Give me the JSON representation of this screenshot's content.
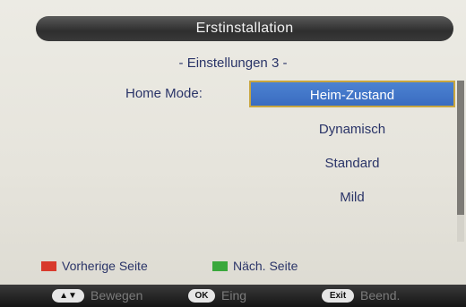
{
  "header": {
    "title": "Erstinstallation"
  },
  "page": {
    "subtitle": "- Einstellungen 3 -"
  },
  "home_mode": {
    "label": "Home Mode:",
    "options": [
      "Heim-Zustand",
      "Dynamisch",
      "Standard",
      "Mild"
    ],
    "selected": "Heim-Zustand"
  },
  "legend": {
    "prev": {
      "label": "Vorherige Seite",
      "color": "#d83a2c"
    },
    "next": {
      "label": "Näch. Seite",
      "color": "#3aa83c"
    }
  },
  "footer": {
    "move": {
      "key": "▲▼",
      "label": "Bewegen"
    },
    "ok": {
      "key": "OK",
      "label": "Eing"
    },
    "exit": {
      "key": "Exit",
      "label": "Beend."
    }
  },
  "colors": {
    "accent": "#3a6cc0",
    "text": "#2a3468",
    "bar": "#2e2e2e"
  }
}
